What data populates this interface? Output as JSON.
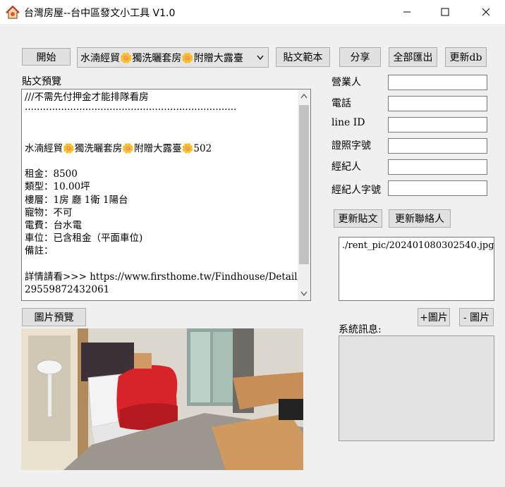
{
  "window": {
    "title": "台灣房屋--台中區發文小工具 V1.0",
    "controls": {
      "minimize": "—",
      "maximize": "☐",
      "close": "✕"
    }
  },
  "toolbar": {
    "start": "開始",
    "template_selected": "水湳經貿🌼獨洗曬套房🌼附贈大露臺",
    "post_template": "貼文範本",
    "share": "分享",
    "export_all": "全部匯出",
    "update_db": "更新db"
  },
  "preview": {
    "label": "貼文預覽",
    "lines": [
      "///不需先付押金才能排隊看房",
      "······································································",
      "",
      "",
      "水湳經貿🌼獨洗曬套房🌼附贈大露臺🌼502",
      "",
      "租金：8500",
      "類型：10.00坪",
      "樓層：1房 廳 1衛 1陽台",
      "寵物：不可",
      "電費：台水電",
      "車位：已含租金（平面車位)",
      "備註：",
      "",
      "詳情請看>>> https://www.firsthome.tw/Findhouse/Detail/",
      "29559872432061",
      "·····································································"
    ]
  },
  "contact": {
    "salesperson": "營業人",
    "phone": "電話",
    "line_id": "line ID",
    "license_no": "證照字號",
    "agent": "經紀人",
    "agent_license_no": "經紀人字號"
  },
  "actions": {
    "update_post": "更新貼文",
    "update_contact": "更新聯絡人",
    "add_image": "+圖片",
    "remove_image": "- 圖片"
  },
  "images": {
    "files": [
      "./rent_pic/202401080302540.jpg"
    ],
    "preview_button": "圖片預覽"
  },
  "system": {
    "label": "系統訊息:"
  }
}
